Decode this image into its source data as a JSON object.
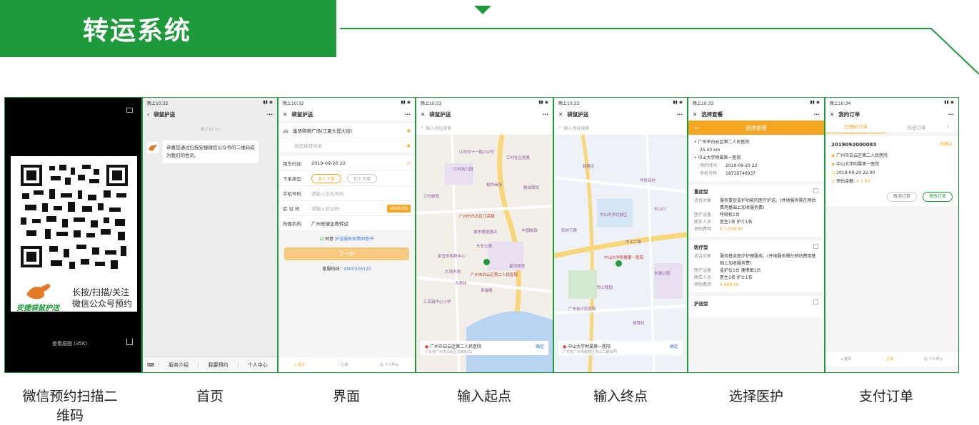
{
  "header": {
    "title": "转运系统"
  },
  "colors": {
    "brand_green": "#1f9a3a",
    "accent_orange": "#f5a623"
  },
  "captions": [
    "微信预约扫描二维码",
    "首页",
    "界面",
    "输入起点",
    "输入终点",
    "选择医护",
    "支付订单"
  ],
  "screen1": {
    "slogan1": "长按/扫描/关注",
    "slogan2": "微信公众号预约",
    "brand": "安捷袋鼠护送",
    "view_original": "查看原图 (35K)"
  },
  "screen2": {
    "time": "晚上10:32",
    "title": "袋鼠护送",
    "chat_time": "晚上10:32",
    "message": "恭喜您通过扫描安捷微信公众号的二维码成为我们的会员。",
    "menu": [
      "服务介绍",
      "我要预约",
      "个人中心"
    ]
  },
  "screen3": {
    "time": "晚上10:32",
    "title": "袋鼠护送",
    "start": "集贤购物广场(江夏大堤大街)",
    "dest_placeholder": "请选择目的地",
    "rows": [
      {
        "label": "用车时间",
        "value": "2019-09-20 22"
      },
      {
        "label": "下单类型",
        "value": ""
      },
      {
        "label": "手机号码",
        "value": "请输入手机号码"
      },
      {
        "label": "验 证 码",
        "value": "请输入验证码"
      },
      {
        "label": "所属机构",
        "value": "广州安捷急救转运"
      }
    ],
    "order_types": [
      "本人下单",
      "代人下单"
    ],
    "get_code": "获取验证码",
    "agree": "同意",
    "agreement": "护送服务知情同意书",
    "next": "下一步",
    "hotline_label": "客服热线：",
    "hotline": "4000326120",
    "tabs": [
      "首页",
      "订单",
      "个人中心"
    ]
  },
  "screen4": {
    "time": "晚上10:33",
    "title": "袋鼠护送",
    "search_placeholder": "输入地址搜索",
    "place": "广州市白云区第二人民医院",
    "address": "广东省广州市白云区北新街32",
    "confirm": "确定",
    "labels": [
      "江村村十一路162号",
      "江村社区居委",
      "江村幼儿园",
      "粮油菜饮",
      "江村邮政",
      "和祥商场",
      "广州市白云区江高镇",
      "城市便捷酒店",
      "东安公寓",
      "大湾市场",
      "家宜多购物中心",
      "广州市白云区第二人民医院",
      "大茶林",
      "中国邮政",
      "星河宾馆",
      "阜福楼",
      "江高镇中心小学"
    ]
  },
  "screen5": {
    "time": "晚上10:33",
    "title": "袋鼠护送",
    "search_placeholder": "输入地址搜索",
    "place": "中山大学附属第一医院",
    "address": "广东省广州市越秀区中山二路58号",
    "confirm": "确定",
    "labels": [
      "中山大学附属第一医院",
      "越秀区",
      "中山二路",
      "华侨新村",
      "东山口",
      "中山大学北校区",
      "农林下路",
      "广东省人民医院",
      "东湖公园",
      "烈士陵园",
      "杨箕村"
    ]
  },
  "screen6": {
    "time": "晚上10:33",
    "title": "选择套餐",
    "banner": "选择套餐",
    "from": "广州市白云区第二人民医院",
    "distance": "25.40",
    "distance_unit": "km",
    "to": "中山大学附属第一医院",
    "book_time_label": "预约时间",
    "book_time": "2019-09-20 22",
    "phone_label": "手机号码",
    "phone": "18718740937",
    "packages": [
      {
        "name": "重症型",
        "desc_label": "适合对象",
        "desc": "服务重症监护功能的医疗护送。(并地服务需在预估费用基础上加收服务费)",
        "equip_label": "医疗设备",
        "equip": "呼吸机1台",
        "staff_label": "随车人员",
        "staff": "医生1名 护士1名",
        "fee_label": "预估费用",
        "fee": "¥ 1,008.00"
      },
      {
        "name": "医疗型",
        "desc_label": "适合对象",
        "desc": "服务基本医疗护理服务。(并地服务需在预估费用基础上加收服务费)",
        "equip_label": "医疗设备",
        "equip": "监护仪1台 便携氧1台",
        "staff_label": "随车人员",
        "staff": "医生1名 护士1名",
        "fee_label": "预估费用",
        "fee": "¥ 688.00"
      },
      {
        "name": "护送型"
      }
    ]
  },
  "screen7": {
    "time": "晚上10:34",
    "title": "我的订单",
    "tabs": [
      "已预约订单",
      "历史订单"
    ],
    "order_no": "2019092000083",
    "status": "待确认",
    "from": "广州市白云区第二人民医院",
    "to": "中山大学附属第一医院",
    "time_val": "2019-09-20 22:00",
    "price_label": "预估金额:",
    "price": "¥ 1.00",
    "cancel": "取消订单",
    "modify": "修改订单",
    "bottom_tabs": [
      "首页",
      "订单",
      "个人中心"
    ]
  }
}
